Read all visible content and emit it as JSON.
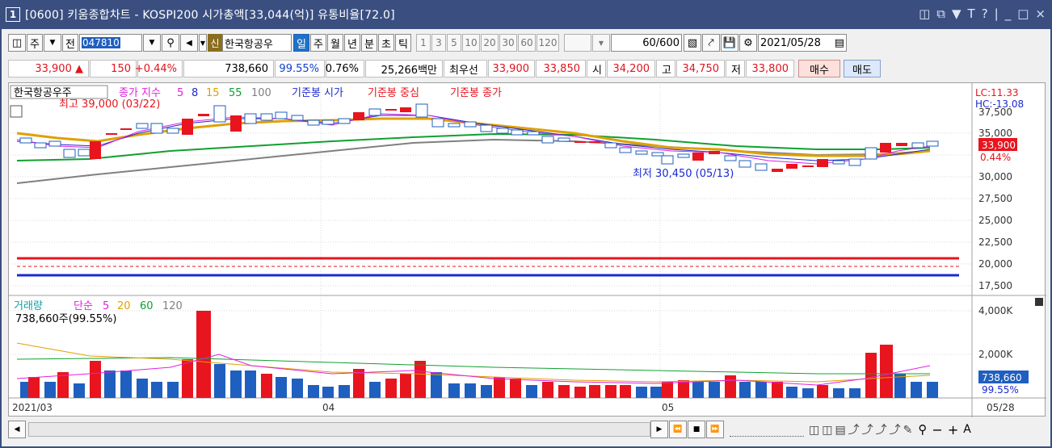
{
  "window": {
    "num": "1",
    "title": "[0600] 키움종합차트 - KOSPI200 시가총액[33,044(억)] 유통비율[72.0]",
    "controls": [
      "□",
      "⧉",
      "▼",
      "T",
      "?",
      "|",
      "_",
      "□",
      "×"
    ]
  },
  "toolbar": {
    "period_select": "주",
    "prev_label": "전",
    "code": "047810",
    "stock_name": "한국항공우",
    "sin_badge": "신",
    "periods": [
      "일",
      "주",
      "월",
      "년",
      "분",
      "초",
      "틱"
    ],
    "selected_period": "일",
    "minutes": [
      "1",
      "3",
      "5",
      "10",
      "20",
      "30",
      "60",
      "120"
    ],
    "count": "60",
    "count_total": "/600",
    "date": "2021/05/28"
  },
  "quote": {
    "price": "33,900",
    "change": "150",
    "change_pct": "+0.44%",
    "volume": "738,660",
    "vol_ratio": "99.55%",
    "turnover": "0.76%",
    "amount": "25,266백만",
    "best_label": "최우선",
    "ask": "33,900",
    "bid": "33,850",
    "open_label": "시",
    "open": "34,200",
    "high_label": "고",
    "high": "34,750",
    "low_label": "저",
    "low": "33,800",
    "buy_label": "매수",
    "sell_label": "매도"
  },
  "legend": {
    "stock": "한국항공우주",
    "ma_label": "종가 지수",
    "ma5": "5",
    "ma8": "8",
    "ma15": "15",
    "ma55": "55",
    "ma100": "100",
    "ref_open": "기준봉 시가",
    "ref_mid": "기준봉 중심",
    "ref_close": "기준봉 종가",
    "lc": "LC:11.33",
    "hc": "HC:-13.08",
    "max_note": "최고 39,000 (03/22)",
    "min_note": "최저 30,450 (05/13)",
    "price_tag": "33,900",
    "pct_tag": "0.44%"
  },
  "volume_legend": {
    "title": "거래량",
    "ma_label": "단순",
    "ma5": "5",
    "ma20": "20",
    "ma60": "60",
    "ma120": "120",
    "value_note": "738,660주(99.55%)",
    "tag": "738,660",
    "tag_pct": "99.55%"
  },
  "price_axis": [
    "35,000",
    "32,500",
    "30,000",
    "27,500",
    "25,000",
    "22,500",
    "20,000",
    "17,500"
  ],
  "price_axis_top": "37,500",
  "volume_axis": [
    "4,000K",
    "2,000K"
  ],
  "date_axis": [
    "2021/03",
    "04",
    "05",
    "05/28"
  ],
  "colors": {
    "up": "#e8141e",
    "down": "#1f5fbf",
    "ma5": "#e020e0",
    "ma8": "#1a2ad0",
    "ma15": "#e0a000",
    "ma55": "#10a030",
    "ma100": "#808080"
  },
  "chart_data": {
    "type": "candlestick",
    "ylim": [
      16500,
      38500
    ],
    "candles_approx": "up/down boxes",
    "volume_ylim": [
      0,
      4600
    ]
  }
}
